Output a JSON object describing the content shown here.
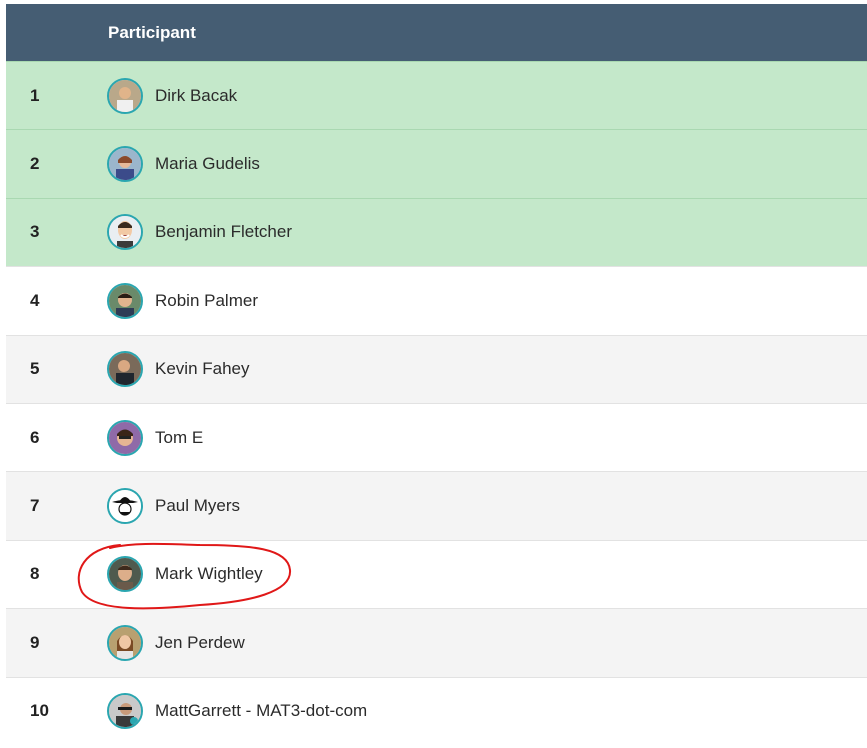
{
  "header": {
    "participant_label": "Participant"
  },
  "rows": [
    {
      "rank": "1",
      "name": "Dirk Bacak",
      "highlight": true
    },
    {
      "rank": "2",
      "name": "Maria Gudelis",
      "highlight": true
    },
    {
      "rank": "3",
      "name": "Benjamin Fletcher",
      "highlight": true
    },
    {
      "rank": "4",
      "name": "Robin Palmer",
      "highlight": false
    },
    {
      "rank": "5",
      "name": "Kevin Fahey",
      "highlight": false
    },
    {
      "rank": "6",
      "name": "Tom E",
      "highlight": false
    },
    {
      "rank": "7",
      "name": "Paul Myers",
      "highlight": false
    },
    {
      "rank": "8",
      "name": "Mark Wightley",
      "highlight": false
    },
    {
      "rank": "9",
      "name": "Jen Perdew",
      "highlight": false
    },
    {
      "rank": "10",
      "name": "MattGarrett - MAT3-dot-com",
      "highlight": false
    }
  ],
  "colors": {
    "header_bg": "#455d73",
    "top_rank_bg": "#c4e8ca",
    "avatar_ring": "#2aa6b0",
    "annotation": "#e01818"
  },
  "annotation": {
    "icon": "red-hand-drawn-circle",
    "target": "Mark Wightley"
  }
}
